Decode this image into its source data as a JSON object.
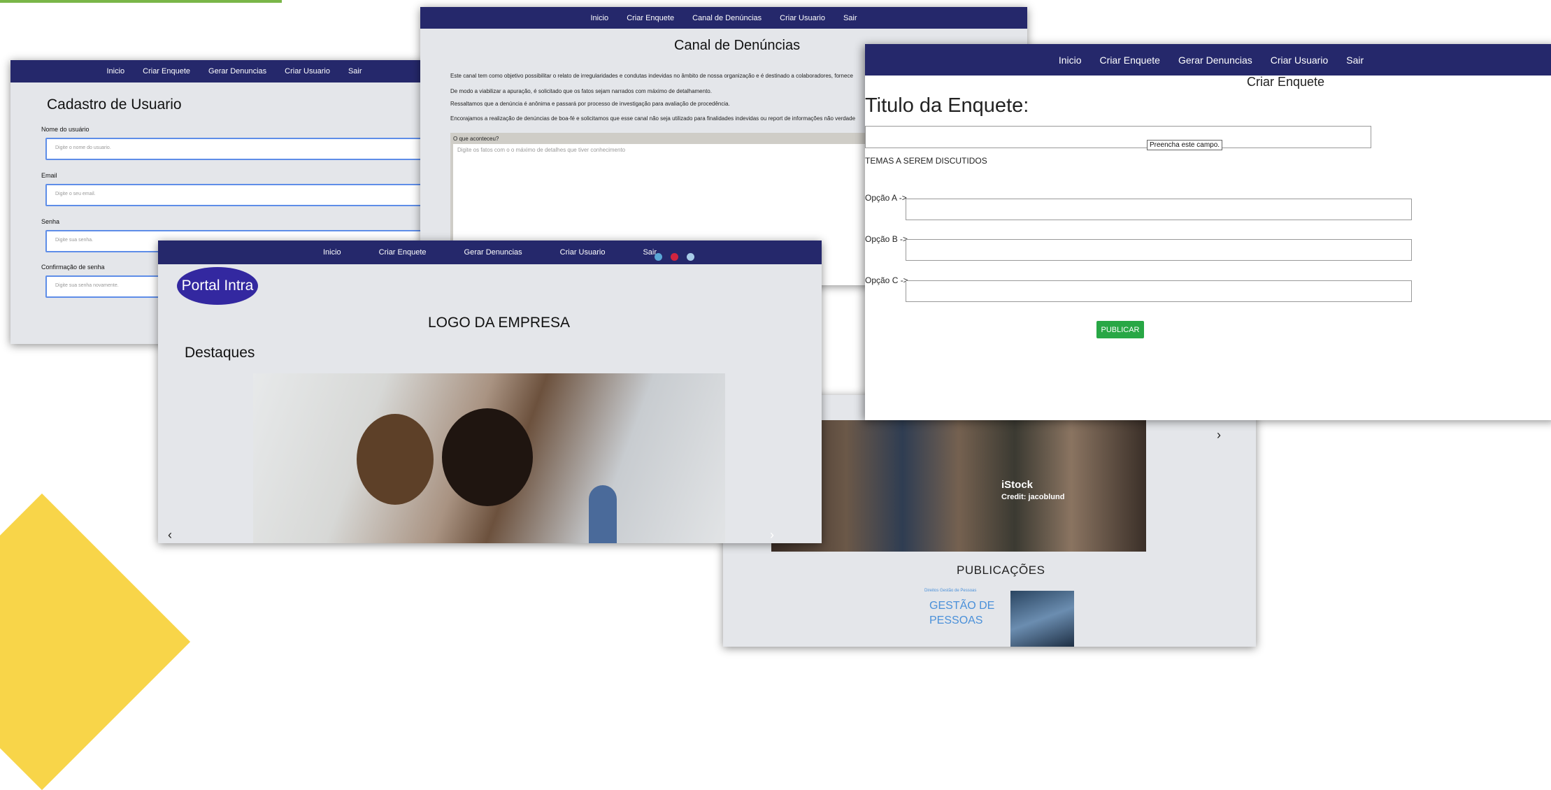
{
  "cadastro": {
    "nav": [
      "Inicio",
      "Criar Enquete",
      "Gerar Denuncias",
      "Criar Usuario",
      "Sair"
    ],
    "title": "Cadastro de Usuario",
    "fields": [
      {
        "label": "Nome do usuário",
        "placeholder": "Digite o nome do usuario."
      },
      {
        "label": "Email",
        "placeholder": "Digite o seu email."
      },
      {
        "label": "Senha",
        "placeholder": "Digite sua senha."
      },
      {
        "label": "Confirmação de senha",
        "placeholder": "Digite sua senha novamente."
      }
    ]
  },
  "canal": {
    "nav": [
      "Inicio",
      "Criar Enquete",
      "Canal de Denúncias",
      "Criar Usuario",
      "Sair"
    ],
    "title": "Canal de Denúncias",
    "paragraphs": [
      "Este canal tem como objetivo possibilitar o relato de irregularidades e condutas indevidas no âmbito de nossa organização e é destinado a colaboradores, fornece",
      "De modo a viabilizar a apuração, é solicitado que os fatos sejam narrados com máximo de detalhamento.",
      "Ressaltamos que a denúncia é anônima e passará por processo de investigação para avaliação de procedência.",
      "Encorajamos a realização de denúncias de boa-fé e solicitamos que esse canal não seja utilizado para finalidades indevidas ou report de informações não verdade"
    ],
    "question_label": "O que aconteceu?",
    "textarea_placeholder": "Digite os fatos com o o máximo de detalhes que tiver conhecimento"
  },
  "home": {
    "watermark_brand": "iStock",
    "watermark_credit": "Credit: jacoblund",
    "next_arrow": "›",
    "publications_title": "PUBLICAÇÕES",
    "pub_small": "Direitos Gestão de Pessoas",
    "pub_title_line1": "GESTÃO DE",
    "pub_title_line2": "PESSOAS"
  },
  "portal": {
    "nav": [
      "Inicio",
      "Criar Enquete",
      "Gerar Denuncias",
      "Criar Usuario",
      "Sair"
    ],
    "logo": "Portal Intra",
    "logo_placeholder": "LOGO DA EMPRESA",
    "highlights_title": "Destaques",
    "prev_arrow": "‹",
    "next_arrow": "›",
    "dot_colors": [
      "#5aa7d6",
      "#d1243f",
      "#a8cbe8"
    ]
  },
  "enquete": {
    "nav": [
      "Inicio",
      "Criar Enquete",
      "Gerar Denuncias",
      "Criar Usuario",
      "Sair"
    ],
    "subtitle": "Criar Enquete",
    "title": "Titulo da Enquete:",
    "tooltip": "Preencha este campo.",
    "topics_label": "TEMAS A SEREM DISCUTIDOS",
    "options": [
      "Opção A ->",
      "Opção B ->",
      "Opção C ->"
    ],
    "publish_label": "PUBLICAR"
  },
  "colors": {
    "nav": "#25286b",
    "accent_green": "#28a745",
    "input_focus": "#5e8de8",
    "deco_yellow": "#f8d549",
    "deco_green": "#7ab648"
  }
}
